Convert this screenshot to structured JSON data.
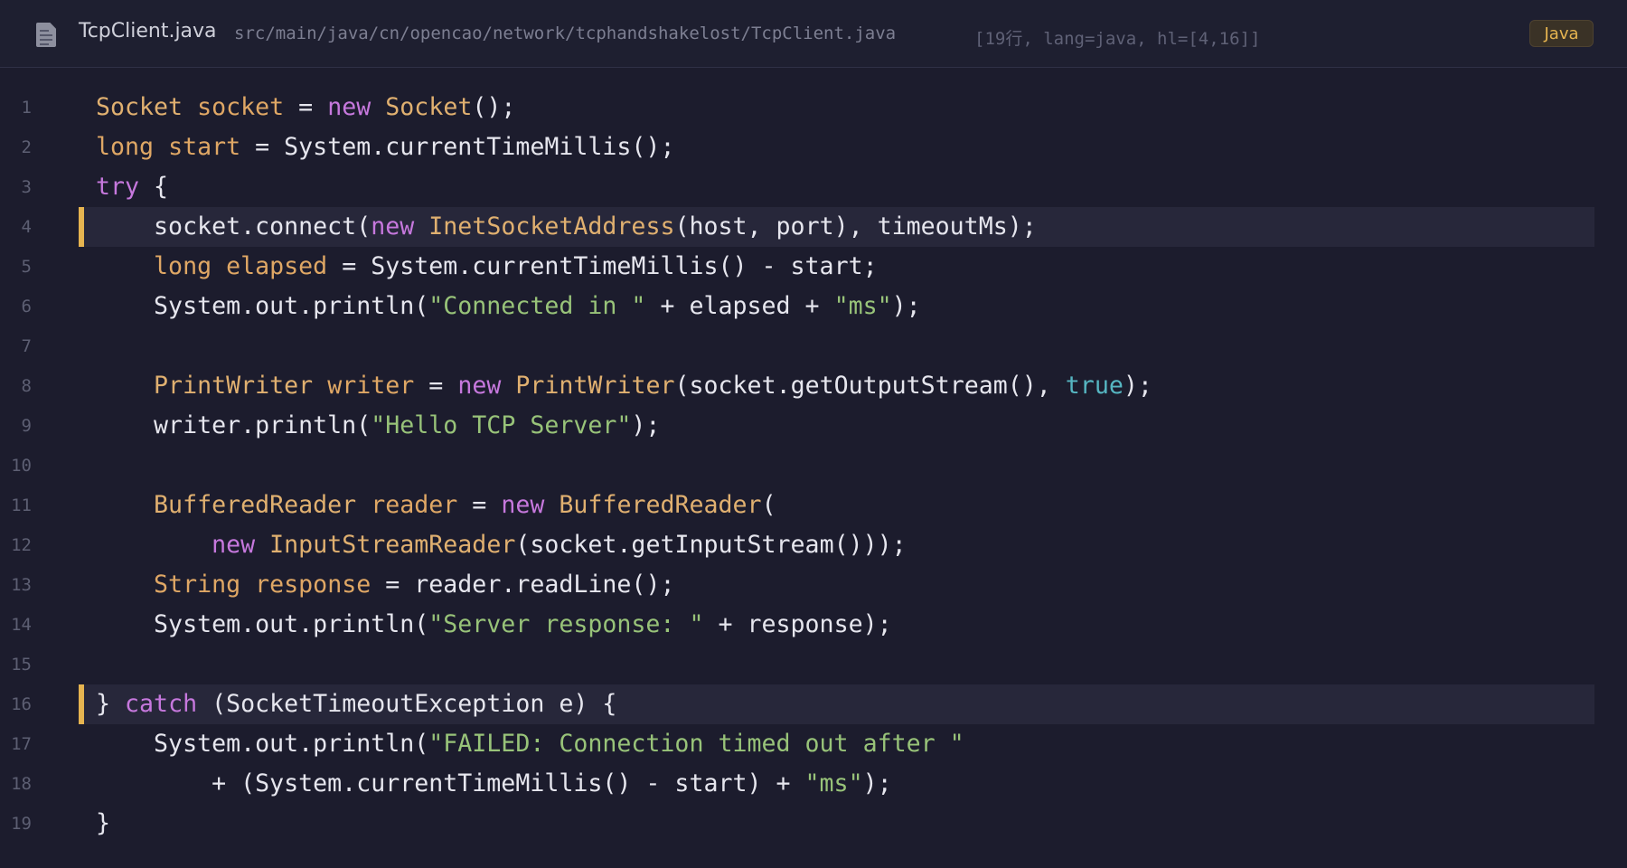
{
  "header": {
    "file_icon": "document-icon",
    "file_name": "TcpClient.java",
    "file_path": "src/main/java/cn/opencao/network/tcphandshakelost/TcpClient.java",
    "meta": "[19行, lang=java, hl=[4,16]]",
    "language_badge": "Java"
  },
  "colors": {
    "background": "#1c1c2d",
    "keyword": "#c678dd",
    "type": "#e0b070",
    "variable": "#dfa765",
    "string": "#98c379",
    "boolean": "#56b6c2",
    "plain": "#e6e6ee",
    "highlight_bar": "#e6b450"
  },
  "editor": {
    "highlighted_lines": [
      4,
      16
    ],
    "lines": [
      {
        "number": "1",
        "tokens": [
          {
            "t": "Socket",
            "k": "ty"
          },
          {
            "t": " ",
            "k": "pl"
          },
          {
            "t": "socket",
            "k": "vr"
          },
          {
            "t": " = ",
            "k": "pl"
          },
          {
            "t": "new",
            "k": "kw"
          },
          {
            "t": " ",
            "k": "pl"
          },
          {
            "t": "Socket",
            "k": "ty"
          },
          {
            "t": "();",
            "k": "pl"
          }
        ]
      },
      {
        "number": "2",
        "tokens": [
          {
            "t": "long",
            "k": "vr"
          },
          {
            "t": " ",
            "k": "pl"
          },
          {
            "t": "start",
            "k": "vr"
          },
          {
            "t": " = System.currentTimeMillis();",
            "k": "pl"
          }
        ]
      },
      {
        "number": "3",
        "tokens": [
          {
            "t": "try",
            "k": "kw"
          },
          {
            "t": " {",
            "k": "pl"
          }
        ]
      },
      {
        "number": "4",
        "tokens": [
          {
            "t": "    socket.connect(",
            "k": "pl"
          },
          {
            "t": "new",
            "k": "kw"
          },
          {
            "t": " ",
            "k": "pl"
          },
          {
            "t": "InetSocketAddress",
            "k": "ty"
          },
          {
            "t": "(host, port), timeoutMs);",
            "k": "pl"
          }
        ]
      },
      {
        "number": "5",
        "tokens": [
          {
            "t": "    ",
            "k": "pl"
          },
          {
            "t": "long",
            "k": "vr"
          },
          {
            "t": " ",
            "k": "pl"
          },
          {
            "t": "elapsed",
            "k": "vr"
          },
          {
            "t": " = System.currentTimeMillis() - start;",
            "k": "pl"
          }
        ]
      },
      {
        "number": "6",
        "tokens": [
          {
            "t": "    System.out.println(",
            "k": "pl"
          },
          {
            "t": "\"Connected in \"",
            "k": "st"
          },
          {
            "t": " + elapsed + ",
            "k": "pl"
          },
          {
            "t": "\"ms\"",
            "k": "st"
          },
          {
            "t": ");",
            "k": "pl"
          }
        ]
      },
      {
        "number": "7",
        "tokens": []
      },
      {
        "number": "8",
        "tokens": [
          {
            "t": "    ",
            "k": "pl"
          },
          {
            "t": "PrintWriter",
            "k": "ty"
          },
          {
            "t": " ",
            "k": "pl"
          },
          {
            "t": "writer",
            "k": "vr"
          },
          {
            "t": " = ",
            "k": "pl"
          },
          {
            "t": "new",
            "k": "kw"
          },
          {
            "t": " ",
            "k": "pl"
          },
          {
            "t": "PrintWriter",
            "k": "ty"
          },
          {
            "t": "(socket.getOutputStream(), ",
            "k": "pl"
          },
          {
            "t": "true",
            "k": "bl"
          },
          {
            "t": ");",
            "k": "pl"
          }
        ]
      },
      {
        "number": "9",
        "tokens": [
          {
            "t": "    writer.println(",
            "k": "pl"
          },
          {
            "t": "\"Hello TCP Server\"",
            "k": "st"
          },
          {
            "t": ");",
            "k": "pl"
          }
        ]
      },
      {
        "number": "10",
        "tokens": []
      },
      {
        "number": "11",
        "tokens": [
          {
            "t": "    ",
            "k": "pl"
          },
          {
            "t": "BufferedReader",
            "k": "ty"
          },
          {
            "t": " ",
            "k": "pl"
          },
          {
            "t": "reader",
            "k": "vr"
          },
          {
            "t": " = ",
            "k": "pl"
          },
          {
            "t": "new",
            "k": "kw"
          },
          {
            "t": " ",
            "k": "pl"
          },
          {
            "t": "BufferedReader",
            "k": "ty"
          },
          {
            "t": "(",
            "k": "pl"
          }
        ]
      },
      {
        "number": "12",
        "tokens": [
          {
            "t": "        ",
            "k": "pl"
          },
          {
            "t": "new",
            "k": "kw"
          },
          {
            "t": " ",
            "k": "pl"
          },
          {
            "t": "InputStreamReader",
            "k": "ty"
          },
          {
            "t": "(socket.getInputStream()));",
            "k": "pl"
          }
        ]
      },
      {
        "number": "13",
        "tokens": [
          {
            "t": "    ",
            "k": "pl"
          },
          {
            "t": "String",
            "k": "vr"
          },
          {
            "t": " ",
            "k": "pl"
          },
          {
            "t": "response",
            "k": "vr"
          },
          {
            "t": " = reader.readLine();",
            "k": "pl"
          }
        ]
      },
      {
        "number": "14",
        "tokens": [
          {
            "t": "    System.out.println(",
            "k": "pl"
          },
          {
            "t": "\"Server response: \"",
            "k": "st"
          },
          {
            "t": " + response);",
            "k": "pl"
          }
        ]
      },
      {
        "number": "15",
        "tokens": []
      },
      {
        "number": "16",
        "tokens": [
          {
            "t": "} ",
            "k": "pl"
          },
          {
            "t": "catch",
            "k": "kw"
          },
          {
            "t": " (SocketTimeoutException e) {",
            "k": "pl"
          }
        ]
      },
      {
        "number": "17",
        "tokens": [
          {
            "t": "    System.out.println(",
            "k": "pl"
          },
          {
            "t": "\"FAILED: Connection timed out after \"",
            "k": "st"
          }
        ]
      },
      {
        "number": "18",
        "tokens": [
          {
            "t": "        + (System.currentTimeMillis() - start) + ",
            "k": "pl"
          },
          {
            "t": "\"ms\"",
            "k": "st"
          },
          {
            "t": ");",
            "k": "pl"
          }
        ]
      },
      {
        "number": "19",
        "tokens": [
          {
            "t": "}",
            "k": "pl"
          }
        ]
      }
    ]
  }
}
